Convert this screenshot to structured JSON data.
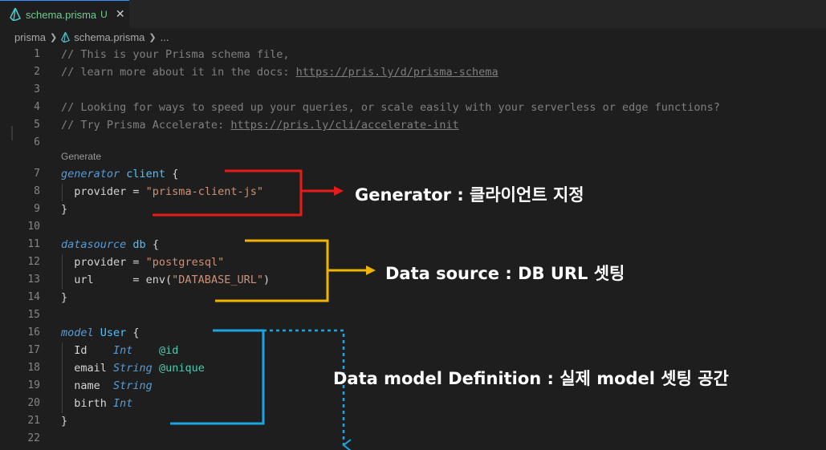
{
  "tab": {
    "filename": "schema.prisma",
    "badge": "U",
    "close": "✕"
  },
  "breadcrumb": {
    "folder": "prisma",
    "file": "schema.prisma",
    "more": "..."
  },
  "codelens": "Generate",
  "lines": [
    {
      "n": "1",
      "parts": [
        [
          "cmt",
          "// This is your Prisma schema file,"
        ]
      ]
    },
    {
      "n": "2",
      "parts": [
        [
          "cmt",
          "// learn more about it in the docs: "
        ],
        [
          "cmt link",
          "https://pris.ly/d/prisma-schema"
        ]
      ]
    },
    {
      "n": "3",
      "parts": []
    },
    {
      "n": "4",
      "parts": [
        [
          "cmt",
          "// Looking for ways to speed up your queries, or scale easily with your serverless or edge functions?"
        ]
      ]
    },
    {
      "n": "5",
      "parts": [
        [
          "cmt",
          "// Try Prisma Accelerate: "
        ],
        [
          "cmt link",
          "https://pris.ly/cli/accelerate-init"
        ]
      ]
    },
    {
      "n": "6",
      "parts": []
    },
    {
      "n": "7",
      "parts": [
        [
          "kw",
          "generator"
        ],
        [
          "",
          " "
        ],
        [
          "ident",
          "client"
        ],
        [
          "",
          " {"
        ]
      ]
    },
    {
      "n": "8",
      "parts": [
        [
          "",
          "  provider = "
        ],
        [
          "str",
          "\"prisma-client-js\""
        ]
      ]
    },
    {
      "n": "9",
      "parts": [
        [
          "",
          "}"
        ]
      ]
    },
    {
      "n": "10",
      "parts": []
    },
    {
      "n": "11",
      "parts": [
        [
          "kw",
          "datasource"
        ],
        [
          "",
          " "
        ],
        [
          "ident",
          "db"
        ],
        [
          "",
          " {"
        ]
      ]
    },
    {
      "n": "12",
      "parts": [
        [
          "",
          "  provider = "
        ],
        [
          "str",
          "\"postgresql\""
        ]
      ]
    },
    {
      "n": "13",
      "parts": [
        [
          "",
          "  url      = env("
        ],
        [
          "str",
          "\"DATABASE_URL\""
        ],
        [
          "",
          ")"
        ]
      ]
    },
    {
      "n": "14",
      "parts": [
        [
          "",
          "}"
        ]
      ]
    },
    {
      "n": "15",
      "parts": []
    },
    {
      "n": "16",
      "parts": [
        [
          "kw",
          "model"
        ],
        [
          "",
          " "
        ],
        [
          "ident",
          "User"
        ],
        [
          "",
          " {"
        ]
      ]
    },
    {
      "n": "17",
      "parts": [
        [
          "",
          "  Id    "
        ],
        [
          "type",
          "Int"
        ],
        [
          "",
          "    "
        ],
        [
          "attr",
          "@id"
        ]
      ]
    },
    {
      "n": "18",
      "parts": [
        [
          "",
          "  email "
        ],
        [
          "type",
          "String"
        ],
        [
          "",
          " "
        ],
        [
          "attr",
          "@unique"
        ]
      ]
    },
    {
      "n": "19",
      "parts": [
        [
          "",
          "  name  "
        ],
        [
          "type",
          "String"
        ]
      ]
    },
    {
      "n": "20",
      "parts": [
        [
          "",
          "  birth "
        ],
        [
          "type",
          "Int"
        ]
      ]
    },
    {
      "n": "21",
      "parts": [
        [
          "",
          "}"
        ]
      ]
    },
    {
      "n": "22",
      "parts": []
    }
  ],
  "annotations": {
    "generator": "Generator : 클라이언트 지정",
    "datasource": "Data source : DB URL 셋팅",
    "model": "Data model Definition : 실제 model 셋팅 공간"
  },
  "colors": {
    "red": "#e81b1b",
    "yellow": "#f0b400",
    "blue": "#1ba5e0"
  }
}
